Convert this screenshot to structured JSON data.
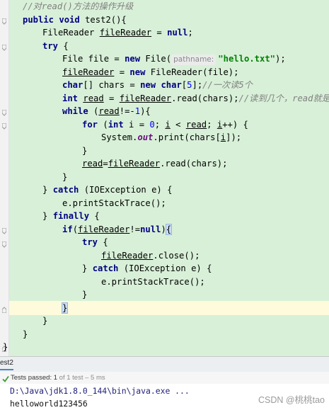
{
  "editor": {
    "lines": {
      "l1": {
        "comment": "//对read()方法的操作升级"
      },
      "l2": {
        "kw1": "public",
        "kw2": "void",
        "text": " test2(){"
      },
      "l3": {
        "type": "FileReader ",
        "var": "fileReader",
        "eq": " = ",
        "kw": "null",
        "end": ";"
      },
      "l4": {
        "kw": "try",
        "end": " {"
      },
      "l5": {
        "pre": "File file = ",
        "kw": "new",
        "mid": " File(",
        "hint": "pathname:",
        "str": "\"hello.txt\"",
        "end": ");"
      },
      "l6": {
        "var": "fileReader",
        "mid": " = ",
        "kw": "new",
        "end": " FileReader(file);"
      },
      "l7": {
        "kw": "char",
        "mid": "[] chars = ",
        "kw2": "new",
        "kw3": "char",
        "pre_num": "[",
        "num": "5",
        "end": "];",
        "comment": "//一次读5个"
      },
      "l8": {
        "kw": "int",
        "sp": " ",
        "var": "read",
        "eq": " = ",
        "var2": "fileReader",
        "end": ".read(chars);",
        "comment": "//读到几个，read就是几"
      },
      "l9": {
        "kw": "while",
        "open": " (",
        "var": "read",
        "op": "!=-",
        "num": "1",
        "end": "){"
      },
      "l10": {
        "kw": "for",
        "open": " (",
        "kw2": "int",
        "a": " i = ",
        "num": "0",
        "b": "; ",
        "v1": "i",
        "c": " < ",
        "v2": "read",
        "d": "; ",
        "v3": "i",
        "e": "++) {"
      },
      "l11": {
        "pre": "System.",
        "it": "out",
        "mid": ".print(chars[",
        "v": "i",
        "end": "]);"
      },
      "l12": {
        "text": "}"
      },
      "l13": {
        "var": "read",
        "eq": "=",
        "var2": "fileReader",
        "end": ".read(chars);"
      },
      "l14": {
        "text": "}"
      },
      "l15": {
        "pre": "} ",
        "kw": "catch",
        "end": " (IOException e) {"
      },
      "l16": {
        "text": "e.printStackTrace();"
      },
      "l17": {
        "pre": "} ",
        "kw": "finally",
        "end": " {"
      },
      "l18": {
        "kw": "if",
        "open": "(",
        "var": "fileReader",
        "mid": "!=",
        "kw2": "null",
        "close": ")",
        "brace": "{"
      },
      "l19": {
        "kw": "try",
        "end": " {"
      },
      "l20": {
        "var": "fileReader",
        "end": ".close();"
      },
      "l21": {
        "pre": "} ",
        "kw": "catch",
        "end": " (IOException e) {"
      },
      "l22": {
        "text": "e.printStackTrace();"
      },
      "l23": {
        "text": "}"
      },
      "l24": {
        "brace": "}"
      },
      "l25": {
        "text": "}"
      },
      "l26": {
        "text": "}"
      },
      "l27": {
        "text": "}"
      }
    }
  },
  "run_panel": {
    "tab_label": "est2",
    "status_bold": "Tests passed: 1",
    "status_rest": " of 1 test – 5 ms",
    "console_cmd": "D:\\Java\\jdk1.8.0_144\\bin\\java.exe ...",
    "console_output": "helloworld123456"
  },
  "watermark": "CSDN @桃桃tao",
  "icons": {
    "fold": "fold-marker-icon",
    "check": "check-icon"
  },
  "colors": {
    "keyword": "#000080",
    "string": "#008000",
    "number": "#0000ff",
    "comment": "#808080",
    "changed_bg": "#d8f0d8",
    "current_line": "#fdfbdc"
  }
}
